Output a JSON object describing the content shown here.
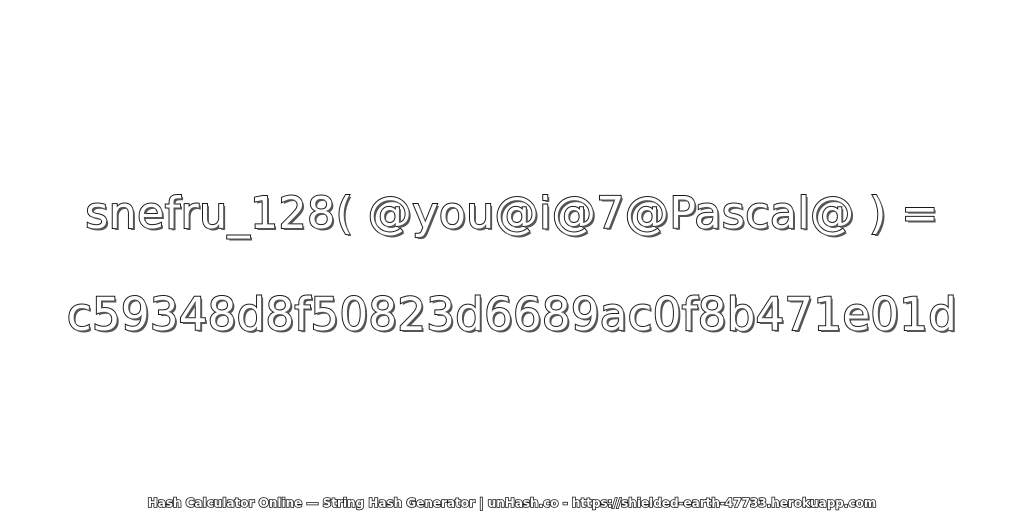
{
  "expression": "snefru_128( @you@i@7@Pascal@ ) =",
  "hash_value": "c59348d8f50823d6689ac0f8b471e01d",
  "footer": "Hash Calculator Online — String Hash Generator | unHash.co - https://shielded-earth-47733.herokuapp.com",
  "colors": {
    "background": "#ffffff",
    "text_fill": "#ffffff",
    "text_outline": "#1a1a1a"
  }
}
